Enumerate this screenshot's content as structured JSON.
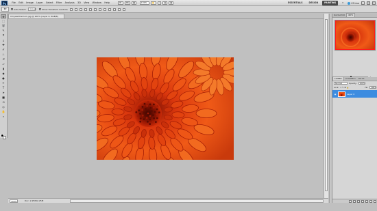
{
  "app": {
    "logo": "Ps"
  },
  "menu": [
    "File",
    "Edit",
    "Image",
    "Layer",
    "Select",
    "Filter",
    "Analysis",
    "3D",
    "View",
    "Window",
    "Help"
  ],
  "appbar": {
    "zoom": "100%",
    "workspaces": [
      "ESSENTIALS",
      "DESIGN",
      "PAINTING"
    ],
    "active_workspace": "PAINTING",
    "cs_live": "CS Live"
  },
  "options": {
    "auto_select": "Auto-Select:",
    "group": "Group",
    "show_transform": "Show Transform Controls"
  },
  "document": {
    "tab": "Chrysanthemum.jpg @ 100% (Layer 0, RGB/8)",
    "zoom": "100%",
    "info": "Doc: 2.25M/2.25M"
  },
  "tools": [
    "move-icon",
    "marquee-icon",
    "lasso-icon",
    "quick-select-icon",
    "crop-icon",
    "eyedropper-icon",
    "healing-icon",
    "brush-icon",
    "stamp-icon",
    "history-brush-icon",
    "eraser-icon",
    "gradient-icon",
    "blur-icon",
    "dodge-icon",
    "pen-icon",
    "type-icon",
    "path-select-icon",
    "shape-icon",
    "3d-rotate-icon",
    "3d-orbit-icon",
    "hand-icon",
    "zoom-icon"
  ],
  "colors": {
    "foreground": "#000000",
    "background": "#ffffff",
    "accent": "#3d8ce0"
  },
  "navigator": {
    "tabs": [
      "NAVIGATOR",
      "INFO"
    ],
    "active": "INFO",
    "zoom": "100%"
  },
  "layers": {
    "tabs": [
      "LAYERS",
      "CHANNELS",
      "PATHS"
    ],
    "blend_mode": "Normal",
    "opacity_label": "Opacity:",
    "opacity": "100%",
    "lock_label": "Lock:",
    "fill_label": "Fill:",
    "fill": "100%",
    "items": [
      {
        "name": "Layer 0"
      }
    ]
  }
}
